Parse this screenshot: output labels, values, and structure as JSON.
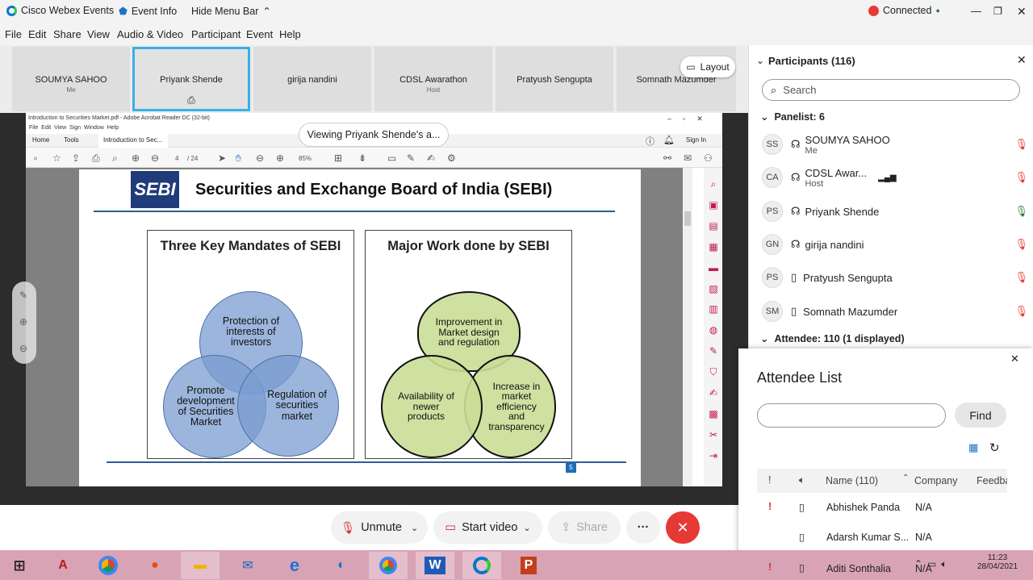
{
  "titlebar": {
    "app_name": "Cisco Webex Events",
    "event_info": "Event Info",
    "hide_menu": "Hide Menu Bar",
    "connected": "Connected"
  },
  "menu": [
    "File",
    "Edit",
    "Share",
    "View",
    "Audio & Video",
    "Participant",
    "Event",
    "Help"
  ],
  "thumbs": [
    {
      "name": "SOUMYA SAHOO",
      "sub": "Me"
    },
    {
      "name": "Priyank Shende",
      "sub": ""
    },
    {
      "name": "girija nandini",
      "sub": ""
    },
    {
      "name": "CDSL Awarathon",
      "sub": "Host"
    },
    {
      "name": "Pratyush Sengupta",
      "sub": ""
    },
    {
      "name": "Somnath Mazumder",
      "sub": ""
    }
  ],
  "layout_label": "Layout",
  "viewing_banner": "Viewing Priyank Shende's a...",
  "acrobat": {
    "title": "Introduction to Securities Market.pdf - Adobe Acrobat Reader DC (32-bit)",
    "menus": "File  Edit  View  Sign  Window  Help",
    "tab_home": "Home",
    "tab_tools": "Tools",
    "tab_doc": "Introduction to Sec...",
    "sign_in": "Sign In",
    "page_num": "4",
    "page_total": "/ 24",
    "zoom": "85%"
  },
  "slide": {
    "logo": "SEBI",
    "title": "Securities and Exchange Board of India (SEBI)",
    "box1_title": "Three Key Mandates of SEBI",
    "box2_title": "Major Work done by SEBI",
    "c1": "Protection of interests of investors",
    "c2": "Promote development of Securities Market",
    "c3": "Regulation of securities market",
    "g1": "Improvement in Market design and regulation",
    "g2": "Availability of newer products",
    "g3": "Increase in market efficiency and transparency",
    "page_no": "5"
  },
  "controls": {
    "unmute": "Unmute",
    "start_video": "Start video",
    "share": "Share",
    "more": "···"
  },
  "panel": {
    "title": "Participants (116)",
    "search_placeholder": "Search",
    "panelist": "Panelist: 6",
    "attendee": "Attendee: 110 (1 displayed)",
    "people": [
      {
        "initials": "SS",
        "name": "SOUMYA SAHOO",
        "sub": "Me"
      },
      {
        "initials": "CA",
        "name": "CDSL Awar...",
        "sub": "Host"
      },
      {
        "initials": "PS",
        "name": "Priyank Shende",
        "sub": ""
      },
      {
        "initials": "GN",
        "name": "girija nandini",
        "sub": ""
      },
      {
        "initials": "PS",
        "name": "Pratyush Sengupta",
        "sub": ""
      },
      {
        "initials": "SM",
        "name": "Somnath Mazumder",
        "sub": ""
      }
    ]
  },
  "attendee_list": {
    "title": "Attendee List",
    "find": "Find",
    "col_name": "Name (110)",
    "col_company": "Company",
    "col_feedback": "Feedba",
    "rows": [
      {
        "name": "Abhishek Panda",
        "company": "N/A",
        "alert": "!"
      },
      {
        "name": "Adarsh Kumar S...",
        "company": "N/A",
        "alert": ""
      },
      {
        "name": "Aditi Sonthalia",
        "company": "N/A",
        "alert": "!"
      }
    ]
  },
  "taskbar": {
    "time": "11:23",
    "date": "28/04/2021"
  }
}
